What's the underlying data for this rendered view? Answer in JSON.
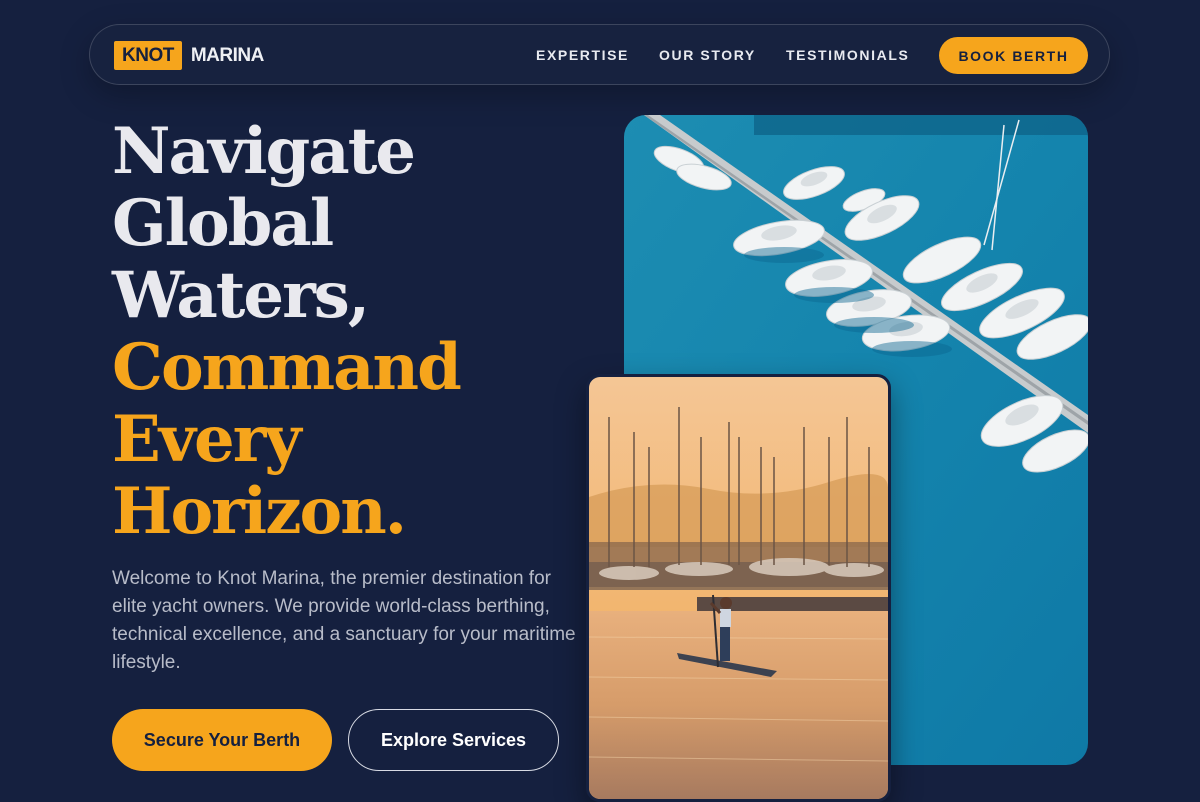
{
  "brand": {
    "badge": "KNOT",
    "name": "MARINA"
  },
  "nav": {
    "links": [
      "EXPERTISE",
      "OUR STORY",
      "TESTIMONIALS"
    ],
    "cta": "BOOK BERTH"
  },
  "hero": {
    "title_lines": [
      "Navigate",
      "Global",
      "Waters,"
    ],
    "title_accent_lines": [
      "Command",
      "Every",
      "Horizon."
    ],
    "description": "Welcome to Knot Marina, the premier destination for elite yacht owners. We provide world-class berthing, technical excellence, and a sanctuary for your maritime lifestyle.",
    "primary_button": "Secure Your Berth",
    "secondary_button": "Explore Services"
  },
  "colors": {
    "background": "#15203f",
    "accent": "#f6a51c",
    "text": "#e9e9ee",
    "muted_text": "#b8bcc9"
  },
  "images": [
    {
      "name": "aerial-marina-photo",
      "alt": "Aerial view of yachts docked at a marina pier"
    },
    {
      "name": "sunset-paddleboard-photo",
      "alt": "Paddleboarder at sunset in a harbor full of sailboats"
    }
  ]
}
